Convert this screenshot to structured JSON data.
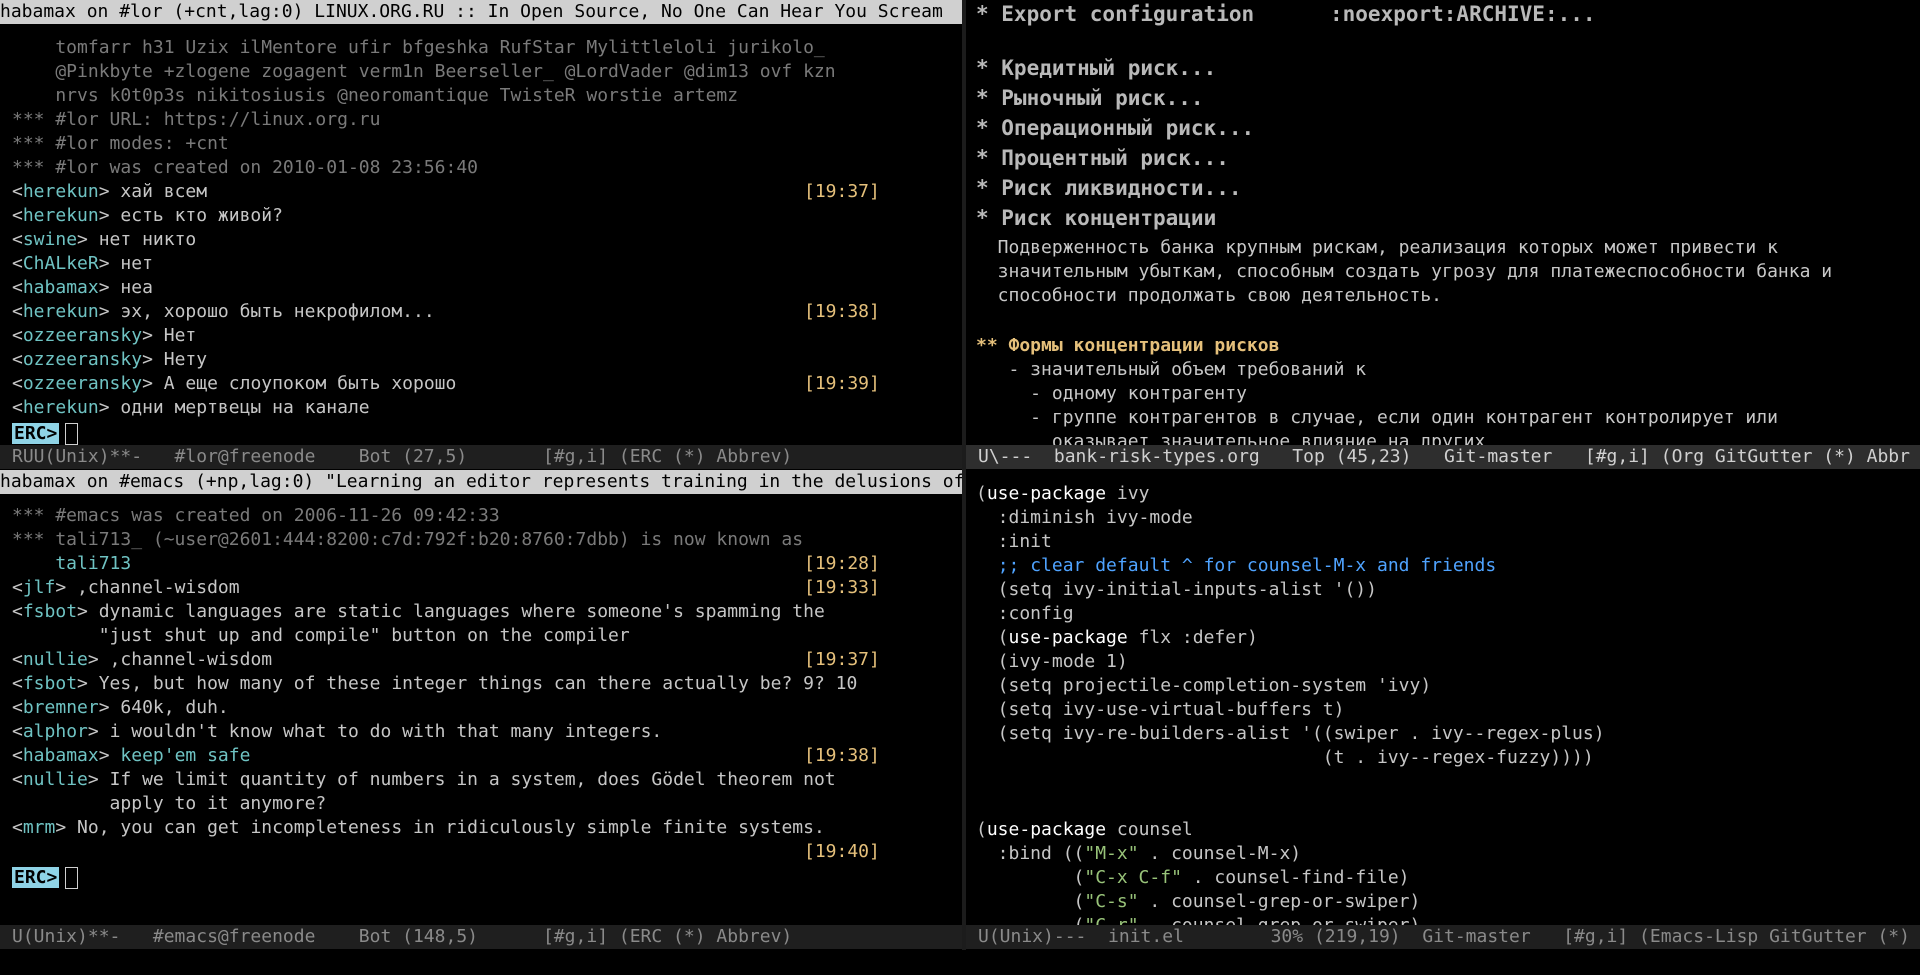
{
  "top_left": {
    "header": "habamax on #lor (+cnt,lag:0) LINUX.ORG.RU :: In Open Source, No One Can Hear You Scream",
    "lines": [
      {
        "cls": "dim",
        "text": "    tomfarr h31 Uzix ilMentore ufir bfgeshka RufStar Mylittleloli jurikolo_"
      },
      {
        "cls": "dim",
        "text": "    @Pinkbyte +zlogene zogagent verm1n Beerseller_ @LordVader @dim13 ovf kzn"
      },
      {
        "cls": "dim",
        "text": "    nrvs k0t0p3s nikitosiusis @neoromantique TwisteR worstie artemz"
      },
      {
        "cls": "dim",
        "text": "*** #lor URL: https://linux.org.ru"
      },
      {
        "cls": "dim",
        "text": "*** #lor modes: +cnt"
      },
      {
        "cls": "dim",
        "text": "*** #lor was created on 2010-01-08 23:56:40"
      }
    ],
    "messages": [
      {
        "nick": "herekun",
        "text": "хай всем",
        "ts": "[19:37]"
      },
      {
        "nick": "herekun",
        "text": "есть кто живой?",
        "ts": ""
      },
      {
        "nick": "swine",
        "text": "нет никто",
        "ts": ""
      },
      {
        "nick": "ChALkeR",
        "text": "нет",
        "ts": ""
      },
      {
        "nick": "habamax",
        "text": "неа",
        "ts": ""
      },
      {
        "nick": "herekun",
        "text": "эх, хорошо быть некрофилом...",
        "ts": "[19:38]"
      },
      {
        "nick": "ozzeeransky",
        "text": "Нет",
        "ts": ""
      },
      {
        "nick": "ozzeeransky",
        "text": "Нету",
        "ts": ""
      },
      {
        "nick": "ozzeeransky",
        "text": "А еще слоупоком быть хорошо",
        "ts": "[19:39]"
      },
      {
        "nick": "herekun",
        "text": "одни мертвецы на канале",
        "ts": ""
      }
    ],
    "prompt": "ERC>",
    "modeline": "RUU(Unix)**-   #lor@freenode    Bot (27,5)       [#g,i] (ERC (*) Abbrev)"
  },
  "bottom_left": {
    "header": "habamax on #emacs (+np,lag:0) \"Learning an editor represents training in the delusions of",
    "lines": [
      {
        "cls": "dim",
        "text": "*** #emacs was created on 2006-11-26 09:42:33"
      },
      {
        "cls": "dim",
        "text": "*** tali713_ (~user@2601:444:8200:c7d:792f:b20:8760:7dbb) is now known as"
      },
      {
        "cls": "nickline",
        "text": "    tali713",
        "ts": "[19:28]"
      }
    ],
    "messages": [
      {
        "nick": "jlf",
        "text": ",channel-wisdom",
        "ts": "[19:33]"
      },
      {
        "nick": "fsbot",
        "text": "dynamic languages are static languages where someone's spamming the",
        "ts": ""
      },
      {
        "nick": "",
        "text": "        \"just shut up and compile\" button on the compiler",
        "ts": ""
      },
      {
        "nick": "nullie",
        "text": ",channel-wisdom",
        "ts": "[19:37]"
      },
      {
        "nick": "fsbot",
        "text": "Yes, but how many of these integer things can there actually be? 9? 10",
        "ts": ""
      },
      {
        "nick": "bremner",
        "text": "640k, duh.",
        "ts": ""
      },
      {
        "nick": "alphor",
        "text": "i wouldn't know what to do with that many integers.",
        "ts": ""
      },
      {
        "nick": "habamax",
        "text": "keep'em safe",
        "ts": "[19:38]",
        "self": true
      },
      {
        "nick": "nullie",
        "text": "If we limit quantity of numbers in a system, does Gödel theorem not",
        "ts": ""
      },
      {
        "nick": "",
        "text": "         apply to it anymore?",
        "ts": ""
      },
      {
        "nick": "mrm",
        "text": "No, you can get incompleteness in ridiculously simple finite systems.",
        "ts": ""
      },
      {
        "nick": "",
        "text": "",
        "ts": "[19:40]"
      }
    ],
    "prompt": "ERC>",
    "modeline": "U(Unix)**-   #emacs@freenode    Bot (148,5)      [#g,i] (ERC (*) Abbrev)"
  },
  "top_right": {
    "lines": [
      {
        "cls": "org1",
        "text": "* Export configuration      :noexport:ARCHIVE:..."
      },
      {
        "cls": "blank",
        "text": ""
      },
      {
        "cls": "org1",
        "text": "* Кредитный риск..."
      },
      {
        "cls": "org1",
        "text": "* Рыночный риск..."
      },
      {
        "cls": "org1",
        "text": "* Операционный риск..."
      },
      {
        "cls": "org1",
        "text": "* Процентный риск..."
      },
      {
        "cls": "org1",
        "text": "* Риск ликвидности..."
      },
      {
        "cls": "org1",
        "text": "* Риск концентрации"
      },
      {
        "cls": "body",
        "text": "  Подверженность банка крупным рискам, реализация которых может привести к"
      },
      {
        "cls": "body",
        "text": "  значительным убыткам, способным создать угрозу для платежеспособности банка и"
      },
      {
        "cls": "body",
        "text": "  способности продолжать свою деятельность."
      },
      {
        "cls": "blank",
        "text": ""
      },
      {
        "cls": "org2",
        "text": "** Формы концентрации рисков"
      },
      {
        "cls": "body",
        "text": "   - значительный объем требований к"
      },
      {
        "cls": "body",
        "text": "     - одному контрагенту"
      },
      {
        "cls": "body",
        "text": "     - группе контрагентов в случае, если один контрагент контролирует или"
      },
      {
        "cls": "body",
        "text": "       оказывает значительное влияние на других"
      }
    ],
    "modeline": "U\\---  bank-risk-types.org   Top (45,23)   Git-master   [#g,i] (Org GitGutter (*) Abbr"
  },
  "bottom_right": {
    "lines": [
      {
        "cls": "code",
        "html": "(<k>use-package</k> ivy"
      },
      {
        "cls": "code",
        "html": "  :diminish ivy-mode"
      },
      {
        "cls": "code",
        "html": "  :init"
      },
      {
        "cls": "code",
        "html": "  <c>;; clear default ^ for counsel-M-x and friends</c>"
      },
      {
        "cls": "code",
        "html": "  (setq ivy-initial-inputs-alist '())"
      },
      {
        "cls": "code",
        "html": "  :config"
      },
      {
        "cls": "code",
        "html": "  (<k>use-package</k> flx :defer)"
      },
      {
        "cls": "code",
        "html": "  (ivy-mode 1)"
      },
      {
        "cls": "code",
        "html": "  (setq projectile-completion-system 'ivy)"
      },
      {
        "cls": "code",
        "html": "  (setq ivy-use-virtual-buffers t)"
      },
      {
        "cls": "code",
        "html": "  (setq ivy-re-builders-alist '((swiper . ivy--regex-plus)"
      },
      {
        "cls": "code",
        "html": "                                (t . ivy--regex-fuzzy))))"
      },
      {
        "cls": "code",
        "html": ""
      },
      {
        "cls": "code",
        "html": ""
      },
      {
        "cls": "code",
        "html": "(<k>use-package</k> counsel"
      },
      {
        "cls": "code",
        "html": "  :bind ((<s>\"M-x\"</s> . counsel-M-x)"
      },
      {
        "cls": "code",
        "html": "         (<s>\"C-x C-f\"</s> . counsel-find-file)"
      },
      {
        "cls": "code",
        "html": "         (<s>\"C-s\"</s> . counsel-grep-or-swiper)"
      },
      {
        "cls": "code",
        "html": "         (<s>\"C-r\"</s> . counsel-grep-or-swiper)"
      }
    ],
    "modeline": "U(Unix)---  init.el        30% (219,19)  Git-master   [#g,i] (Emacs-Lisp GitGutter (*)"
  }
}
